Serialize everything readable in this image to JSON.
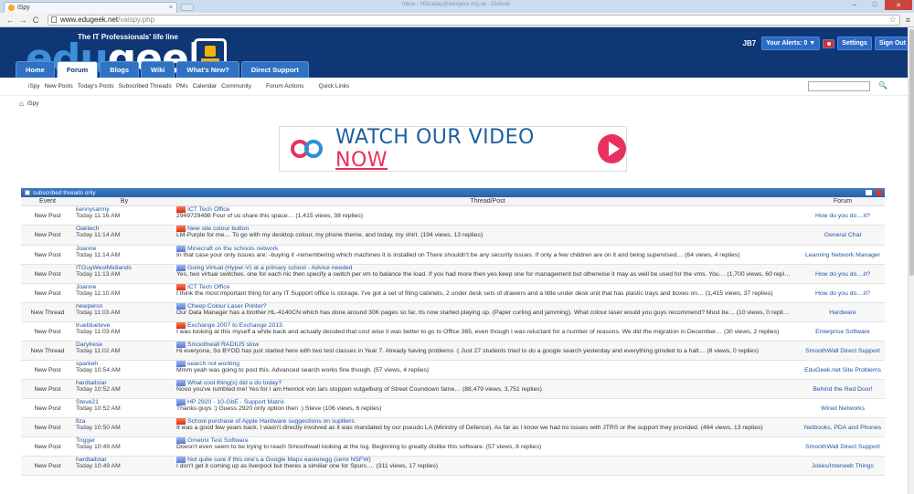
{
  "browser": {
    "tab_title": "iSpy",
    "tab_close": "×",
    "window_title": "Inbox - Nfaraday@edugeek.org.uk - Outlook",
    "url_domain": "www.edugeek.net",
    "url_path": "/vaispy.php",
    "back": "←",
    "forward": "→",
    "reload": "C",
    "star": "☆",
    "menu": "≡",
    "win_minimize": "–",
    "win_maximize": "□",
    "win_close": "✕"
  },
  "header": {
    "tagline": "The IT Professionals' life line",
    "logo_edu": "edu",
    "logo_geek": "geek",
    "username": "JB7",
    "alerts_label": "Your Alerts: 0 ▼",
    "settings_label": "Settings",
    "signout_label": "Sign Out"
  },
  "nav": {
    "tabs": [
      "Home",
      "Forum",
      "Blogs",
      "Wiki",
      "What's New?",
      "Direct Support"
    ],
    "active": "Forum"
  },
  "subnav": {
    "items": [
      "iSpy",
      "New Posts",
      "Today's Posts",
      "Subscribed Threads",
      "PMs",
      "Calendar",
      "Community",
      "Forum Actions",
      "Quick Links"
    ]
  },
  "breadcrumb": {
    "home_icon": "⌂",
    "current": "iSpy"
  },
  "search": {
    "icon": "🔍"
  },
  "banner": {
    "text": "WATCH OUR VIDEO",
    "highlight": "NOW"
  },
  "table": {
    "header_label": "subscribed threads only",
    "columns": [
      "Event",
      "By",
      "Thread/Post",
      "Forum"
    ],
    "rows": [
      {
        "event": "New Post",
        "user": "kennysarmy",
        "time": "Today 11:16 AM",
        "icon": "red",
        "title": "ICT Tech Office",
        "excerpt": "2949729498 Four of us share this space… (1,415 views, 38 replies)",
        "forum": "How do you do....it?"
      },
      {
        "event": "New Post",
        "user": "Oaktech",
        "time": "Today 11:14 AM",
        "icon": "red",
        "title": "New site colour button",
        "excerpt": "LM-Purple for me… To go with my desktop colour, my phone theme, and today, my shirt. (194 views, 13 replies)",
        "forum": "General Chat"
      },
      {
        "event": "New Post",
        "user": "Joanne",
        "time": "Today 11:14 AM",
        "icon": "blue",
        "title": "Minecraft on the schools network",
        "excerpt": "In that case your only issues are: -buying it -remembering which machines it is installed on There shouldn't be any security issues. If only a few children are on it and being supervised… (64 views, 4 replies)",
        "forum": "Learning Network Manager"
      },
      {
        "event": "New Post",
        "user": "ITGuyWestMidlands",
        "time": "Today 11:13 AM",
        "icon": "blue",
        "title": "Going Virtual (Hyper-V) at a primary school - Advice needed",
        "excerpt": "Yes, two virtual switches. one for each nic then specify a switch per vm to balance the load. If you had more then yes keep one for management but otherwise it may as well be used for the vms. You… (1,700 views, 60 replies)",
        "forum": "How do you do....it?"
      },
      {
        "event": "New Post",
        "user": "Joanne",
        "time": "Today 11:10 AM",
        "icon": "red",
        "title": "ICT Tech Office",
        "excerpt": "I think the most important thing for any IT Support office is storage. I've got a set of filing cabinets, 2 under desk sets of drawers and a little under desk unit that has plastic trays and boxes on… (1,415 views, 37 replies)",
        "forum": "How do you do....it?"
      },
      {
        "event": "New Thread",
        "user": "newpersn",
        "time": "Today 11:03 AM",
        "icon": "blue",
        "title": "Cheep Colour Laser Printer?",
        "excerpt": "Our Data Manager has a brother HL-4140CN which has done around 30K pages so far, Its now started playing up. (Paper curling and jamming). What colour laser would you guys recommend? Must be… (10 views, 0 replies)",
        "forum": "Hardware"
      },
      {
        "event": "New Post",
        "user": "trueblueteve",
        "time": "Today 11:03 AM",
        "icon": "red",
        "title": "Exchange 2007 to Exchange 2013",
        "excerpt": "I was looking at this myself a while back and actually decided that cost wise it was better to go to Office 365, even though I was reluctant for a number of reasons. We did the migration in December… (30 views, 2 replies)",
        "forum": "Enterprise Software"
      },
      {
        "event": "New Thread",
        "user": "Darylrese",
        "time": "Today 11:02 AM",
        "icon": "blue",
        "title": "Smoothwall RADIUS slow",
        "excerpt": "Hi everyone, So BYOD has just started here with two test classes in Year 7. Already having problems :( Just 27 students tried to do a google search yesterday and everything grinded to a halt… (8 views, 0 replies)",
        "forum": "SmoothWall Direct Support"
      },
      {
        "event": "New Post",
        "user": "sparkeh",
        "time": "Today 10:54 AM",
        "icon": "blue",
        "title": "search not working",
        "excerpt": "Mmm yeah was going to post this. Advanced search works fine though. (57 views, 4 replies)",
        "forum": "EduGeek.net Site Problems"
      },
      {
        "event": "New Post",
        "user": "hardtailstar",
        "time": "Today 10:52 AM",
        "icon": "blue",
        "title": "What cool thing(s) did u do today?",
        "excerpt": "Nooo you've rumbled me! Yes for I am Henrick von lars stoppen vutgelburg of Street Coundown fame… (88,479 views, 3,751 replies)",
        "forum": "Behind the Red Door!"
      },
      {
        "event": "New Post",
        "user": "Steve21",
        "time": "Today 10:52 AM",
        "icon": "blue",
        "title": "HP 2920 - 10-GbE - Support Matrix",
        "excerpt": "Thanks guys :) Guess 2920 only option then :) Steve (106 views, 6 replies)",
        "forum": "Wired Networks"
      },
      {
        "event": "New Post",
        "user": "fiza",
        "time": "Today 10:50 AM",
        "icon": "red",
        "title": "School purchase of Apple Hardware suggestions on suplliers",
        "excerpt": "It was a good few years back. I wasn't directly involved as it was mandated by our pseudo LA (Ministry of Defence). As far as I know we had no issues with JTRS or the support they provided. (464 views, 13 replies)",
        "forum": "Netbooks, PDA and Phones"
      },
      {
        "event": "New Post",
        "user": "Trigger",
        "time": "Today 10:49 AM",
        "icon": "blue",
        "title": "Gmetrix Test Software",
        "excerpt": "Doesn't even seem to be trying to reach Smoothwall looking at the log. Beginning to greatly dislike this software. (57 views, 8 replies)",
        "forum": "SmoothWall Direct Support"
      },
      {
        "event": "New Post",
        "user": "hardtailstar",
        "time": "Today 10:49 AM",
        "icon": "blue",
        "title": "Not quite sure if this one's a Google Maps easteregg (semi NSFW)",
        "excerpt": "I don't get it coming up as liverpool but theres a similiar one for Spurs…. (311 views, 17 replies)",
        "forum": "Jokes/Interweb Things"
      }
    ]
  },
  "colors": {
    "header_bg": "#0f3775",
    "nav_tab": "#2f72c4",
    "link": "#2255a4",
    "banner_pink": "#e8315e",
    "banner_blue": "#1c5f9e"
  }
}
